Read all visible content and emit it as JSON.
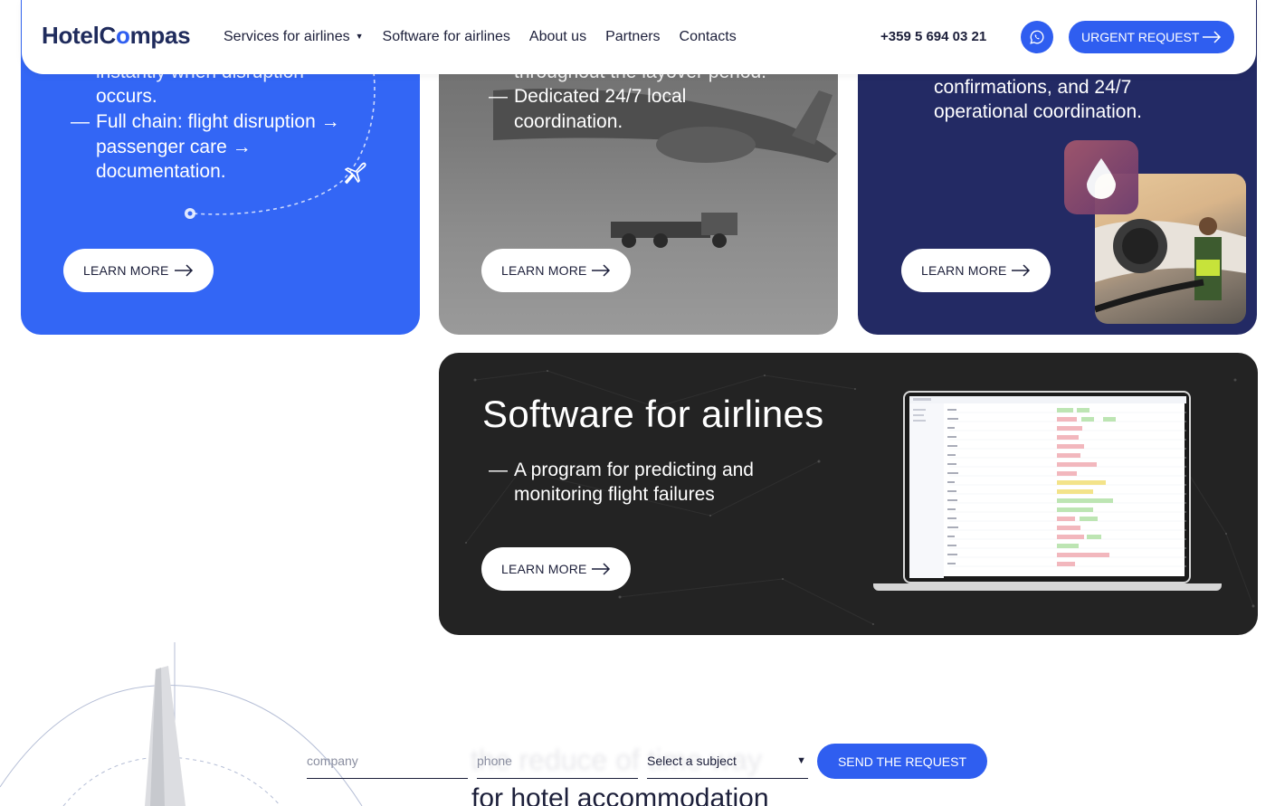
{
  "header": {
    "logo_main": "HotelC",
    "logo_accent": "o",
    "logo_tail": "mpas",
    "nav": [
      {
        "label": "Services for airlines"
      },
      {
        "label": "Software for airlines"
      },
      {
        "label": "About us"
      },
      {
        "label": "Partners"
      },
      {
        "label": "Contacts"
      }
    ],
    "phone": "+359 5 694 03 21",
    "urgent_label": "URGENT REQUEST"
  },
  "cards": {
    "blue": {
      "line_top": "instantly when disruption",
      "bullet1": "occurs.",
      "bullet2": "Full chain: flight disruption →",
      "bullet2b": "passenger care →",
      "bullet2c": "documentation.",
      "learn": "LEARN MORE"
    },
    "photo": {
      "line_top": "throughout the layover period.",
      "bullet1": "Dedicated 24/7 local",
      "bullet1b": "coordination.",
      "learn": "LEARN MORE"
    },
    "navy": {
      "line1": "confirmations, and 24/7",
      "line2": "operational coordination.",
      "learn": "LEARN MORE"
    },
    "software": {
      "title": "Software for airlines",
      "bullet1": "A program for predicting and",
      "bullet1b": "monitoring flight failures",
      "learn": "LEARN MORE"
    }
  },
  "form": {
    "company_placeholder": "company",
    "phone_placeholder": "phone",
    "subject_value": "Select a subject",
    "send_label": "SEND THE REQUEST",
    "heading_partial": "for hotel accommodation"
  },
  "colors": {
    "primary": "#2f5ef0",
    "blue_card": "#3366f5",
    "navy_card": "#232a64",
    "dark_card": "#232323"
  },
  "icons": {
    "whatsapp": "whatsapp-icon",
    "arrow": "arrow-right-icon",
    "drop": "fuel-drop-icon",
    "plane": "plane-icon"
  }
}
